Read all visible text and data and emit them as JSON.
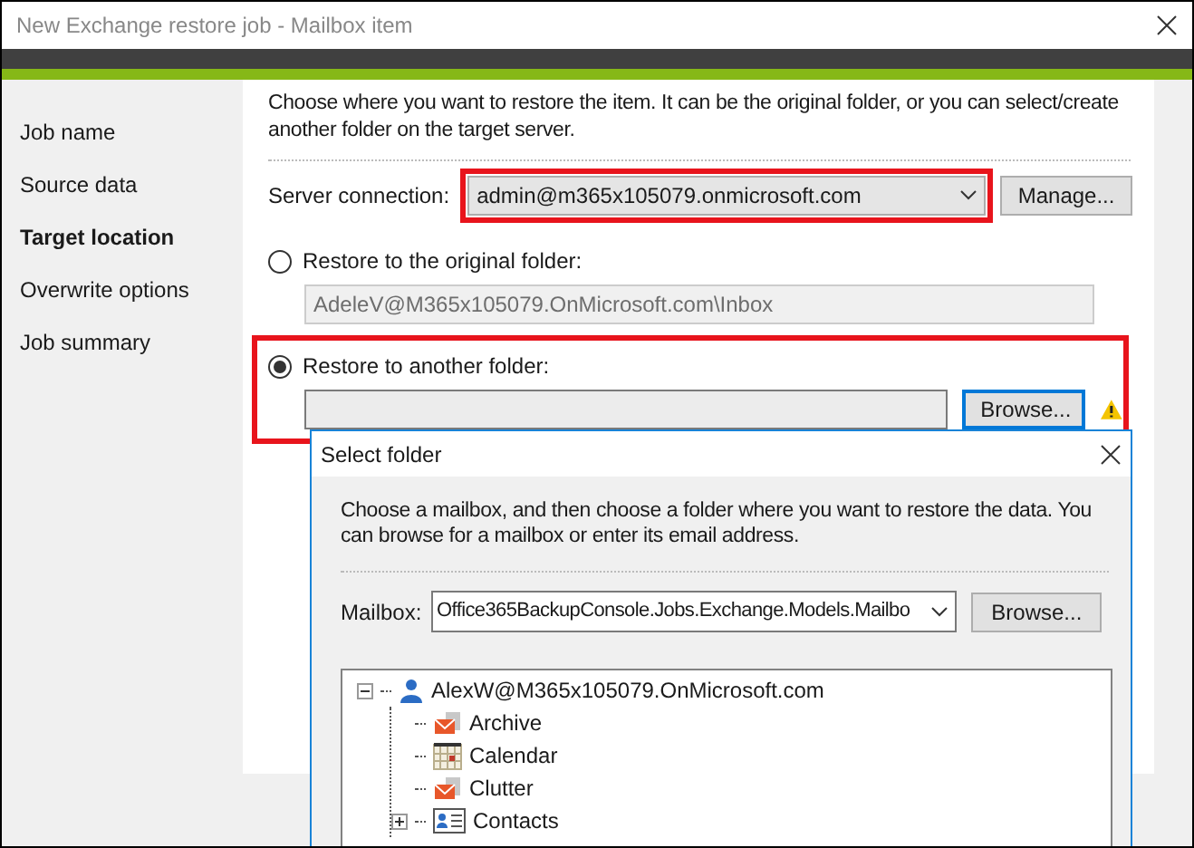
{
  "window": {
    "title": "New Exchange restore job - Mailbox item"
  },
  "sidebar": {
    "items": [
      {
        "label": "Job name",
        "selected": false
      },
      {
        "label": "Source data",
        "selected": false
      },
      {
        "label": "Target location",
        "selected": true
      },
      {
        "label": "Overwrite options",
        "selected": false
      },
      {
        "label": "Job summary",
        "selected": false
      }
    ]
  },
  "content": {
    "intro": "Choose where you want to restore the item. It can be the original folder, or you can select/create another folder on the target server.",
    "server_connection": {
      "label": "Server connection:",
      "value": "admin@m365x105079.onmicrosoft.com",
      "button": "Manage..."
    },
    "options": [
      {
        "label": "Restore to the original folder:",
        "selected": false,
        "value": "AdeleV@M365x105079.OnMicrosoft.com\\Inbox",
        "disabled": true
      },
      {
        "label": "Restore to another folder:",
        "selected": true,
        "disabled": false,
        "button": "Browse...",
        "warning": true
      }
    ]
  },
  "dialog": {
    "title": "Select folder",
    "intro": "Choose a mailbox, and then choose a folder where you want to restore the data. You can browse for a mailbox or enter its email address.",
    "mailbox": {
      "label": "Mailbox:",
      "value": "Office365BackupConsole.Jobs.Exchange.Models.Mailbo",
      "button": "Browse..."
    },
    "tree": [
      {
        "label": "AlexW@M365x105079.OnMicrosoft.com",
        "kind": "user",
        "expanded": true,
        "children": [
          {
            "label": "Archive",
            "kind": "mail"
          },
          {
            "label": "Calendar",
            "kind": "calendar"
          },
          {
            "label": "Clutter",
            "kind": "mail"
          },
          {
            "label": "Contacts",
            "kind": "contacts",
            "expanded": false
          }
        ]
      }
    ]
  }
}
